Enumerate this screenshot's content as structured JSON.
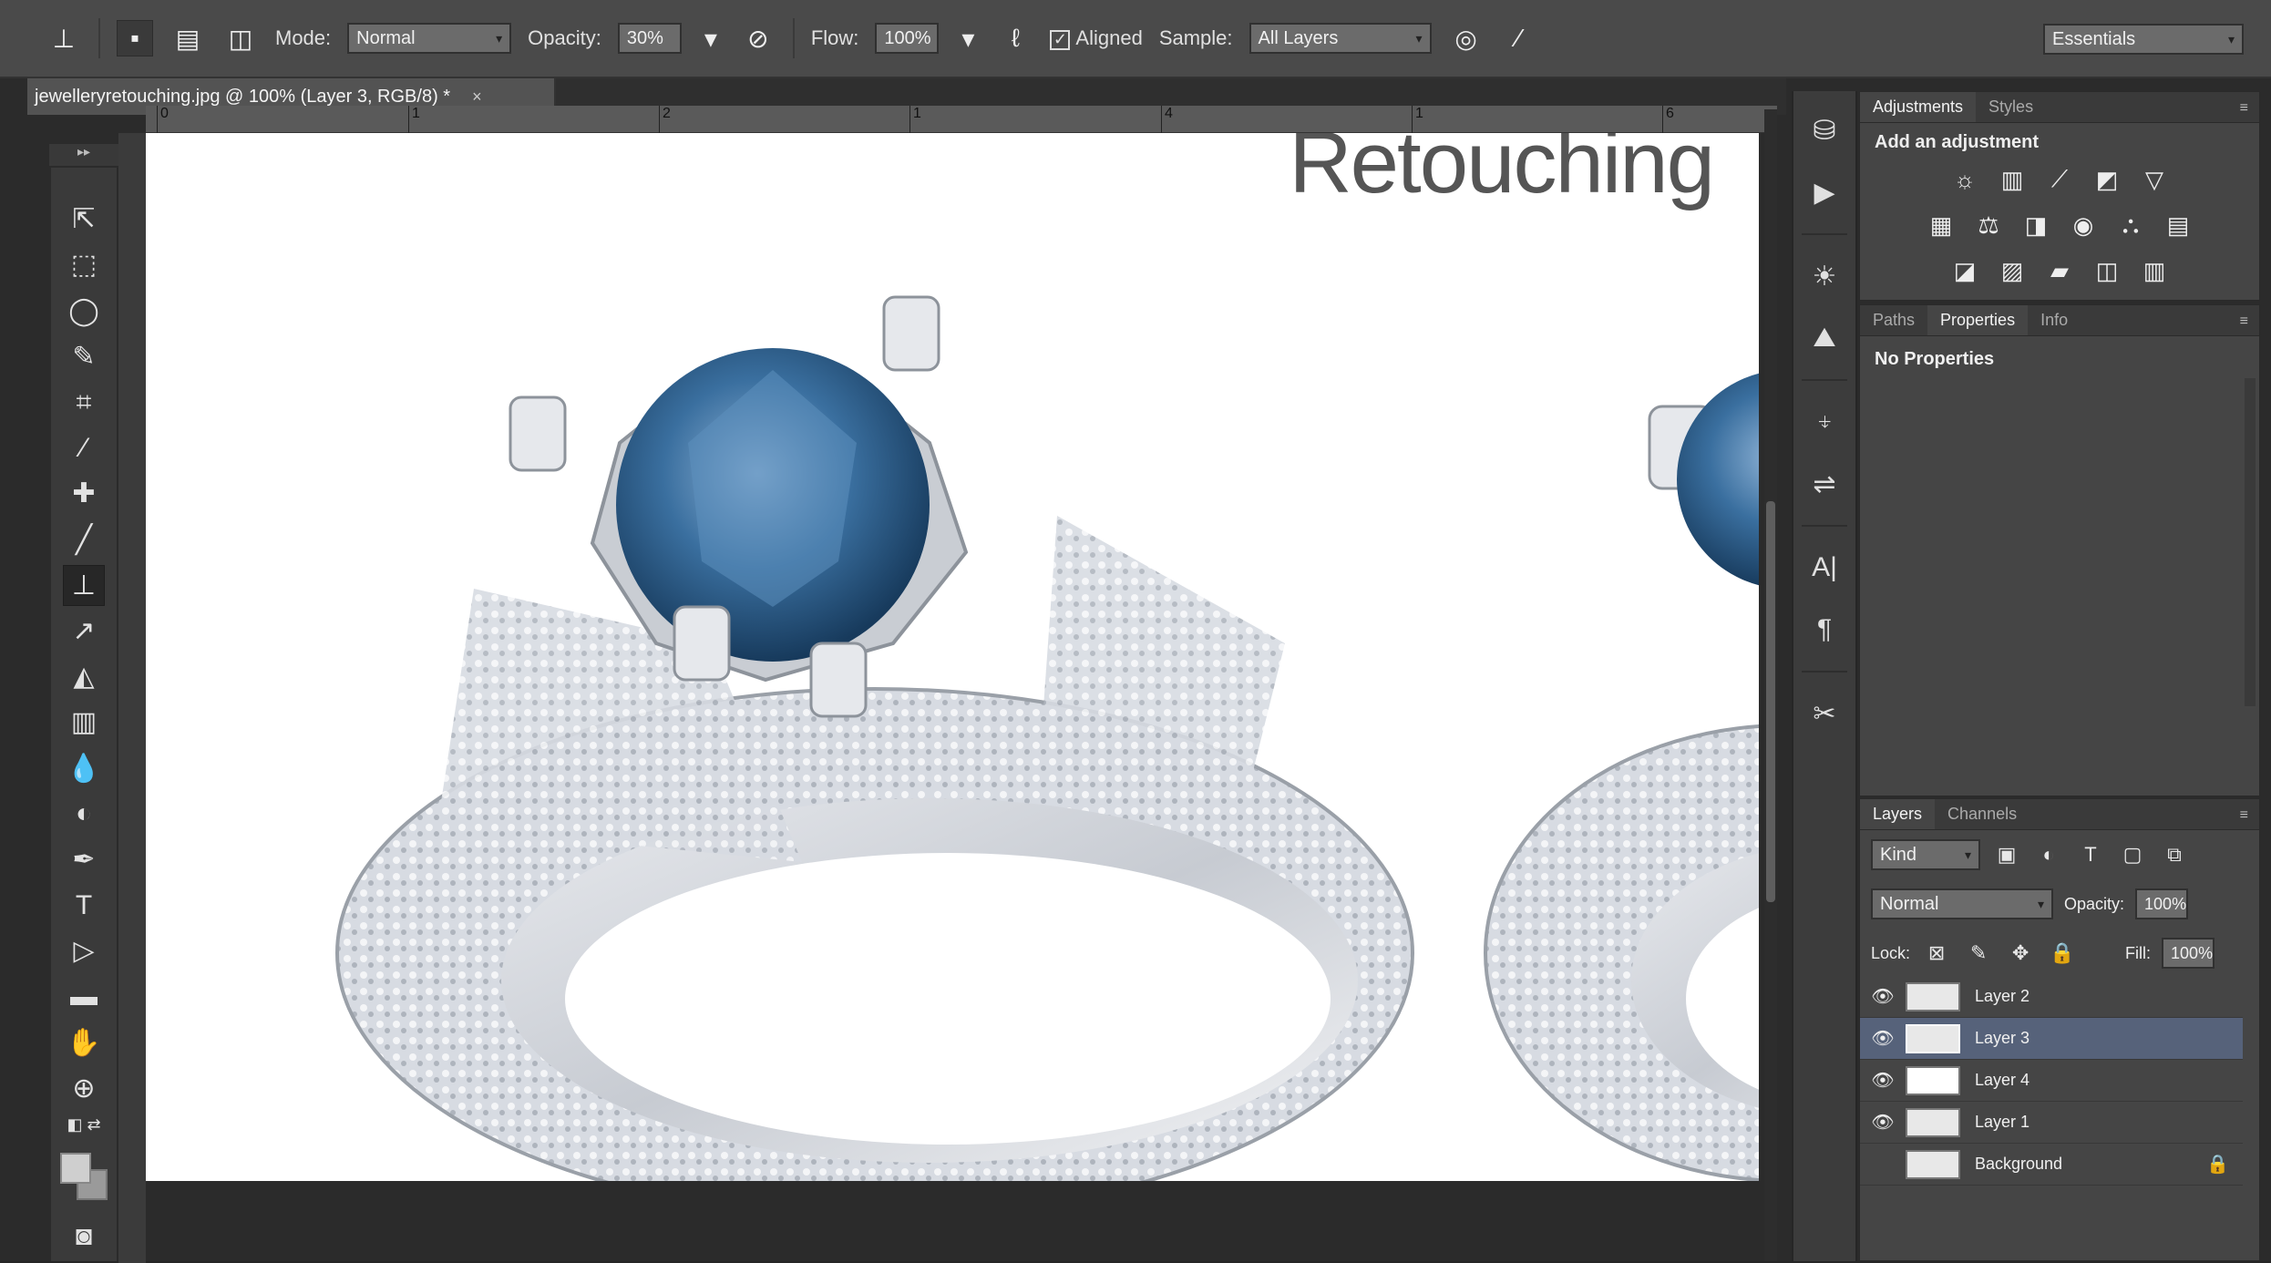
{
  "options_bar": {
    "tool_icon": "clone-stamp-icon",
    "mode_label": "Mode:",
    "mode_value": "Normal",
    "opacity_label": "Opacity:",
    "opacity_value": "30%",
    "flow_label": "Flow:",
    "flow_value": "100%",
    "aligned_label": "Aligned",
    "sample_label": "Sample:",
    "sample_value": "All Layers",
    "workspace_value": "Essentials"
  },
  "document": {
    "tab_title": "jewelleryretouching.jpg @ 100% (Layer 3, RGB/8) *",
    "ruler_numbers": [
      "0",
      "1",
      "2",
      "1",
      "4",
      "1",
      "6"
    ]
  },
  "canvas": {
    "title": "Retouching"
  },
  "panels": {
    "adjustments": {
      "tabs": [
        "Adjustments",
        "Styles"
      ],
      "header": "Add an adjustment"
    },
    "properties": {
      "tabs": [
        "Paths",
        "Properties",
        "Info"
      ],
      "empty_text": "No Properties"
    },
    "layers": {
      "tabs": [
        "Layers",
        "Channels"
      ],
      "kind_value": "Kind",
      "blend_value": "Normal",
      "opacity_label": "Opacity:",
      "opacity_value": "100%",
      "lock_label": "Lock:",
      "fill_label": "Fill:",
      "fill_value": "100%",
      "items": [
        {
          "name": "Layer 2",
          "visible": true,
          "selected": false
        },
        {
          "name": "Layer 3",
          "visible": true,
          "selected": true
        },
        {
          "name": "Layer 4",
          "visible": true,
          "selected": false
        },
        {
          "name": "Layer 1",
          "visible": true,
          "selected": false
        },
        {
          "name": "Background",
          "visible": false,
          "selected": false,
          "locked": true
        }
      ]
    }
  },
  "colors": {
    "selected_layer": "#56627a",
    "canvas_bg": "#ffffff",
    "gem_blue": "#2e5f8e"
  }
}
